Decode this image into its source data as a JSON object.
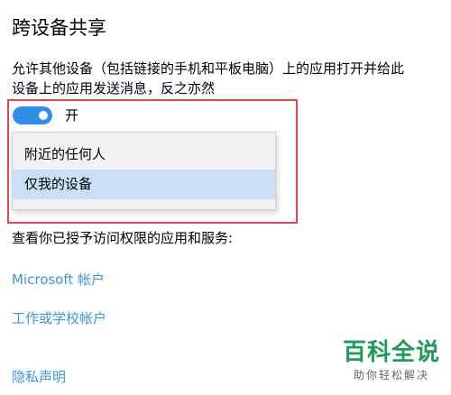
{
  "section": {
    "title": "跨设备共享",
    "description_line1": "允许其他设备（包括链接的手机和平板电脑）上的应用打开并给此",
    "description_line2": "设备上的应用发送消息，反之亦然"
  },
  "toggle": {
    "state": "on",
    "label": "开",
    "accent_color": "#2f8ee6"
  },
  "dropdown": {
    "options": [
      {
        "label": "附近的任何人",
        "selected": false
      },
      {
        "label": "仅我的设备",
        "selected": true
      }
    ],
    "selected_value": "仅我的设备",
    "highlight_color": "#c9e0f7"
  },
  "permissions": {
    "text": "查看你已授予访问权限的应用和服务:"
  },
  "links": {
    "microsoft_account": "Microsoft 帐户",
    "work_school_account": "工作或学校帐户",
    "privacy_statement": "隐私声明",
    "link_color": "#3a96dd"
  },
  "annotation": {
    "highlight_border_color": "#e8474f"
  },
  "watermark": {
    "title": "百科全说",
    "subtitle": "助你轻松解决",
    "color": "#1f9a57"
  }
}
